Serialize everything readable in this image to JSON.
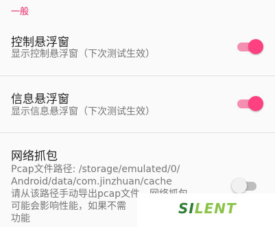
{
  "section": {
    "header": "一般"
  },
  "prefs": [
    {
      "title": "控制悬浮窗",
      "summary": "显示控制悬浮窗（下次测试生效）",
      "enabled": true
    },
    {
      "title": "信息悬浮窗",
      "summary": "显示信息悬浮窗（下次测试生效）",
      "enabled": true
    },
    {
      "title": "网络抓包",
      "summary_lines": [
        "Pcap文件路径: /storage/emulated/0/",
        "Android/data/com.jinzhuan/cache",
        "请从该路径手动导出pcap文件，网络抓包",
        "可能会影响性能，如果不需",
        "功能"
      ],
      "enabled": false
    }
  ],
  "watermark": {
    "brand_first": "SI",
    "brand_accent": "LENT",
    "brand_full": "SILENT"
  },
  "colors": {
    "accent": "#ff4081",
    "header": "#e91e63"
  }
}
